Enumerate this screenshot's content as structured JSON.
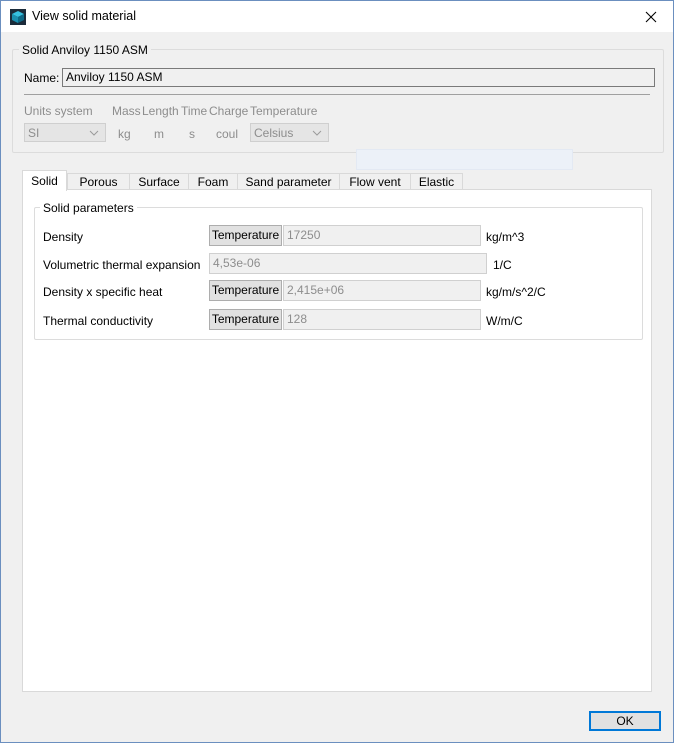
{
  "window": {
    "title": "View solid material"
  },
  "material_group": {
    "title": "Solid Anviloy 1150 ASM",
    "name_label": "Name:",
    "name_value": "Anviloy 1150 ASM"
  },
  "units": {
    "system_label": "Units system",
    "system_value": "SI",
    "mass_label": "Mass",
    "mass_value": "kg",
    "length_label": "Length",
    "length_value": "m",
    "time_label": "Time",
    "time_value": "s",
    "charge_label": "Charge",
    "charge_value": "coul",
    "temperature_label": "Temperature",
    "temperature_value": "Celsius"
  },
  "tabs": [
    {
      "label": "Solid",
      "active": true
    },
    {
      "label": "Porous"
    },
    {
      "label": "Surface"
    },
    {
      "label": "Foam"
    },
    {
      "label": "Sand parameter"
    },
    {
      "label": "Flow vent"
    },
    {
      "label": "Elastic"
    }
  ],
  "solid_params": {
    "title": "Solid parameters",
    "rows": [
      {
        "label": "Density",
        "button": "Temperature",
        "value": "17250",
        "unit": "kg/m^3"
      },
      {
        "label": "Volumetric thermal expansion",
        "value": "4,53e-06",
        "unit": "1/C"
      },
      {
        "label": "Density x specific heat",
        "button": "Temperature",
        "value": "2,415e+06",
        "unit": "kg/m/s^2/C"
      },
      {
        "label": "Thermal conductivity",
        "button": "Temperature",
        "value": "128",
        "unit": "W/m/C"
      }
    ]
  },
  "footer": {
    "ok_label": "OK"
  },
  "colors": {
    "accent": "#0078d7",
    "window_border": "#6b8fbf"
  }
}
